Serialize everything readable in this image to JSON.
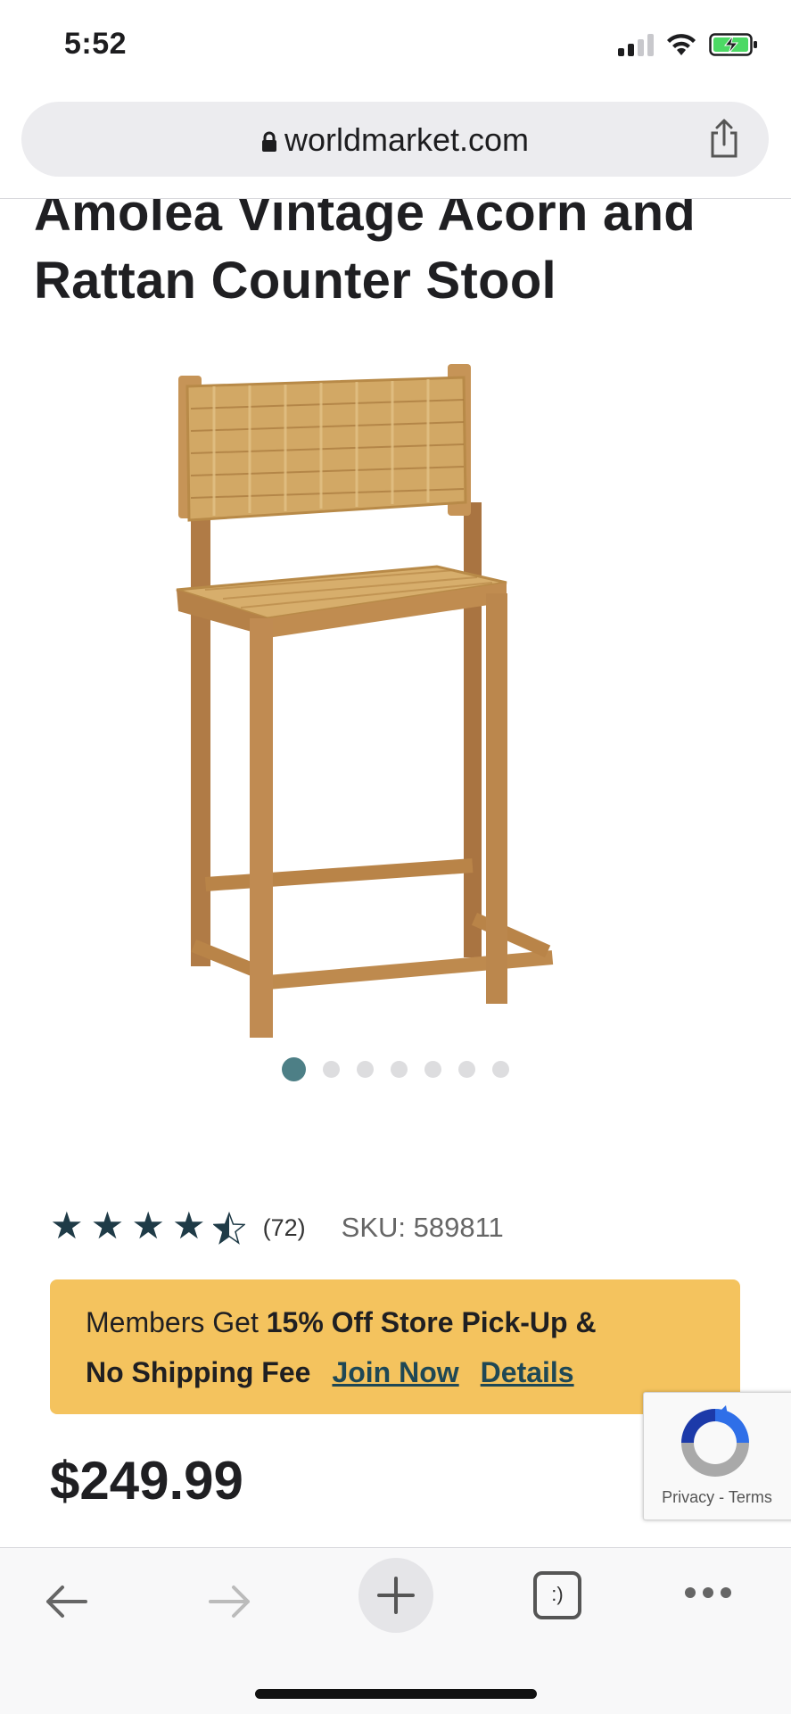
{
  "status_bar": {
    "time": "5:52"
  },
  "browser": {
    "url": "worldmarket.com"
  },
  "product": {
    "title": "Amolea Vintage Acorn and Rattan Counter Stool",
    "rating_value": 4.5,
    "review_count": "(72)",
    "sku": "SKU: 589811",
    "price": "$249.99"
  },
  "carousel": {
    "total": 7,
    "active_index": 0
  },
  "promo": {
    "line1_normal": "Members Get ",
    "line1_bold": "15% Off Store Pick-Up &",
    "line2_bold": "No Shipping Fee",
    "join_label": "Join Now",
    "details_label": "Details"
  },
  "recaptcha": {
    "text": "Privacy - Terms"
  },
  "toolbar": {
    "tab_icon_text": ":)"
  },
  "colors": {
    "accent_teal": "#4d7f86",
    "star_color": "#1f3b47",
    "promo_bg": "#f4c35e",
    "link_color": "#1f4855"
  }
}
